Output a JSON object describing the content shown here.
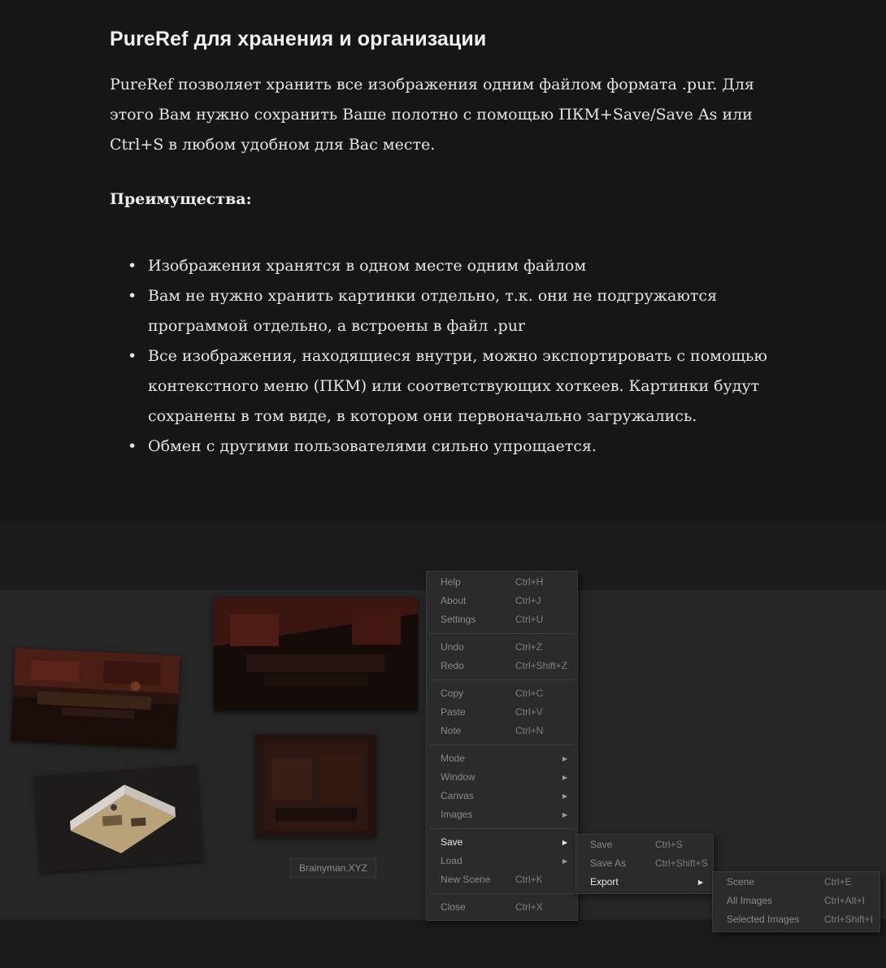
{
  "article": {
    "title": "PureRef для хранения и организации",
    "intro": "PureRef позволяет хранить все изображения одним файлом формата .pur. Для этого Вам нужно сохранить Ваше полотно с помощью ПКМ+Save/Save As или Ctrl+S в любом удобном для Вас месте.",
    "advantages_heading": "Преимущества:",
    "bullets": [
      "Изображения хранятся в одном месте одним файлом",
      "Вам не нужно хранить картинки отдельно, т.к. они не подгружаются программой отдельно, а встроены в файл .pur",
      "Все изображения, находящиеся внутри, можно экспортировать с помощью контекстного меню (ПКМ) или соответствующих хоткеев. Картинки будут сохранены в том виде, в котором они первоначально загружались.",
      "Обмен с другими пользователями сильно упрощается."
    ]
  },
  "canvas": {
    "watermark": "Brainyman.XYZ"
  },
  "context_menu": {
    "help": {
      "label": "Help",
      "shortcut": "Ctrl+H"
    },
    "about": {
      "label": "About",
      "shortcut": "Ctrl+J"
    },
    "settings": {
      "label": "Settings",
      "shortcut": "Ctrl+U"
    },
    "undo": {
      "label": "Undo",
      "shortcut": "Ctrl+Z"
    },
    "redo": {
      "label": "Redo",
      "shortcut": "Ctrl+Shift+Z"
    },
    "copy": {
      "label": "Copy",
      "shortcut": "Ctrl+C"
    },
    "paste": {
      "label": "Paste",
      "shortcut": "Ctrl+V"
    },
    "note": {
      "label": "Note",
      "shortcut": "Ctrl+N"
    },
    "mode": {
      "label": "Mode"
    },
    "window": {
      "label": "Window"
    },
    "canvas": {
      "label": "Canvas"
    },
    "images": {
      "label": "Images"
    },
    "save": {
      "label": "Save"
    },
    "load": {
      "label": "Load"
    },
    "new_scene": {
      "label": "New Scene",
      "shortcut": "Ctrl+K"
    },
    "close": {
      "label": "Close",
      "shortcut": "Ctrl+X"
    }
  },
  "save_submenu": {
    "save": {
      "label": "Save",
      "shortcut": "Ctrl+S"
    },
    "save_as": {
      "label": "Save As",
      "shortcut": "Ctrl+Shift+S"
    },
    "export": {
      "label": "Export"
    }
  },
  "export_submenu": {
    "scene": {
      "label": "Scene",
      "shortcut": "Ctrl+E"
    },
    "all_images": {
      "label": "All Images",
      "shortcut": "Ctrl+Alt+I"
    },
    "selected_images": {
      "label": "Selected Images",
      "shortcut": "Ctrl+Shift+I"
    }
  },
  "icons": {
    "submenu_arrow": "triangle-right-icon"
  },
  "colors": {
    "page_bg": "#161616",
    "canvas_bg": "#262626",
    "menu_bg": "#2b2b2b",
    "highlight_text": "#e8e8e8"
  }
}
